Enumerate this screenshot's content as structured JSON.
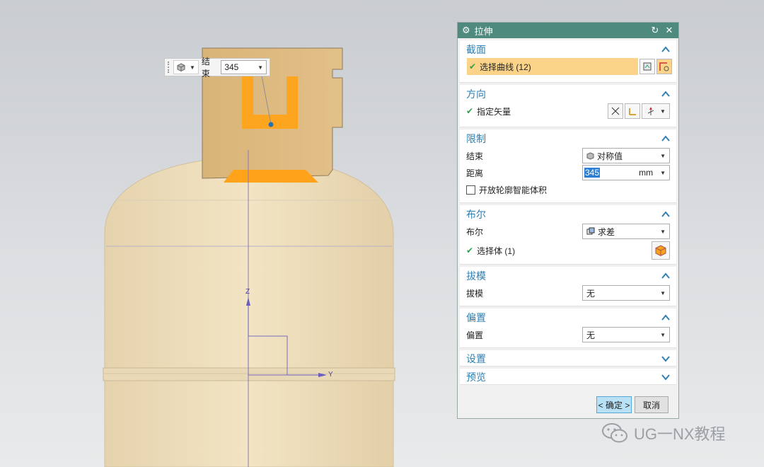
{
  "mini_toolbar": {
    "end_label": "结束",
    "end_value": "345"
  },
  "viewport": {
    "axis_z": "Z",
    "axis_y": "Y"
  },
  "dialog": {
    "title": "拉伸",
    "sections": {
      "section": {
        "header": "截面",
        "select_curve": "选择曲线 (12)"
      },
      "direction": {
        "header": "方向",
        "specify_vector": "指定矢量"
      },
      "limits": {
        "header": "限制",
        "end_label": "结束",
        "end_value": "对称值",
        "distance_label": "距离",
        "distance_value": "345",
        "distance_unit": "mm",
        "open_profile_label": "开放轮廓智能体积"
      },
      "boolean": {
        "header": "布尔",
        "bool_label": "布尔",
        "bool_value": "求差",
        "select_body": "选择体 (1)"
      },
      "draft": {
        "header": "拔模",
        "draft_label": "拔模",
        "draft_value": "无"
      },
      "offset": {
        "header": "偏置",
        "offset_label": "偏置",
        "offset_value": "无"
      },
      "settings": {
        "header": "设置"
      },
      "preview": {
        "header": "预览"
      }
    },
    "ok_button": "< 确定 >",
    "cancel_button": "取消"
  },
  "watermark": {
    "text": "UG一NX教程"
  },
  "colors": {
    "title_bar": "#4f8a7e",
    "section_header": "#2f7fb3",
    "highlight": "#fbd48a",
    "model_body": "#e9d7b4",
    "sketch_orange": "#ffa31a",
    "ok_button": "#b8e1f5"
  }
}
